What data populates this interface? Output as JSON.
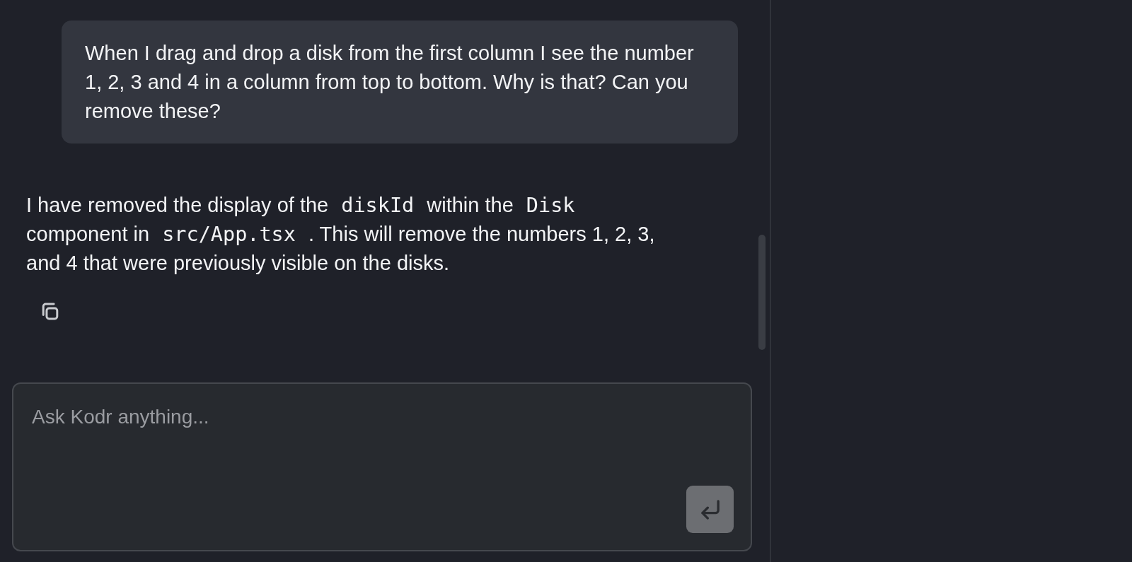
{
  "user_message": {
    "text": "When I drag and drop a disk from the first column I see the number 1, 2, 3 and 4 in a column from top to bottom. Why is that? Can you remove these?"
  },
  "assistant_message": {
    "segments": [
      {
        "kind": "text",
        "text": "I have removed the display of the"
      },
      {
        "kind": "code",
        "text": "diskId"
      },
      {
        "kind": "text",
        "text": "within the"
      },
      {
        "kind": "code",
        "text": "Disk"
      },
      {
        "kind": "text",
        "text": "component in"
      },
      {
        "kind": "code",
        "text": "src/App.tsx"
      },
      {
        "kind": "text",
        "text": ". This will remove the numbers 1, 2, 3, and 4 that were previously visible on the disks."
      }
    ]
  },
  "composer": {
    "placeholder": "Ask Kodr anything...",
    "send_button": {
      "disabled": true
    }
  }
}
